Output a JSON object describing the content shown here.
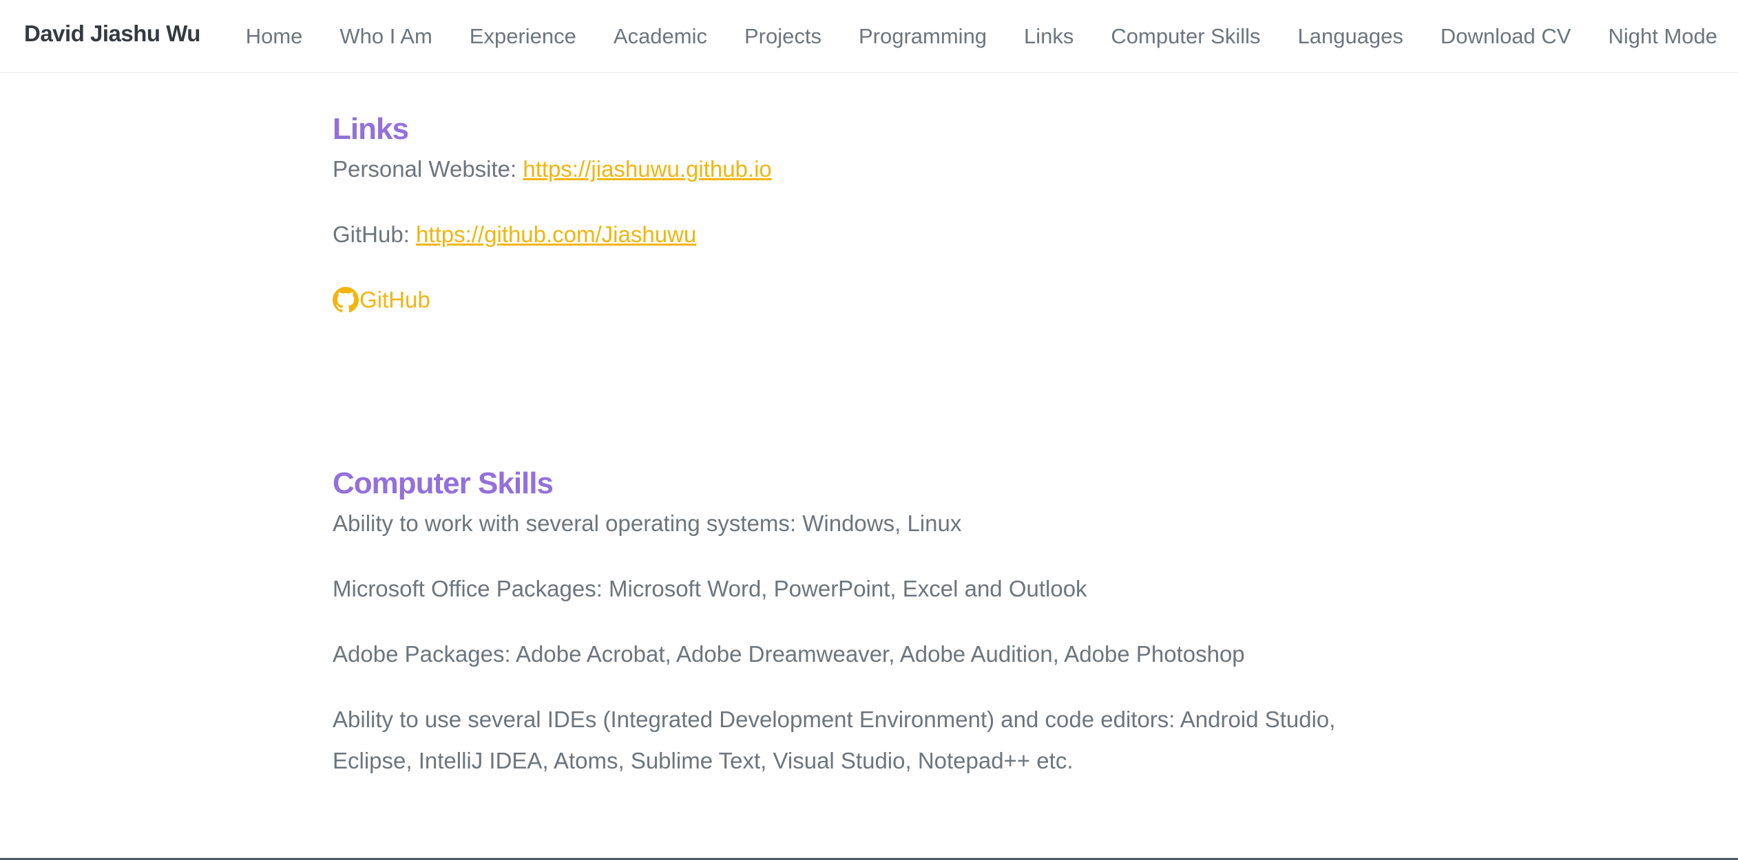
{
  "brand": "David Jiashu Wu",
  "nav": [
    {
      "label": "Home"
    },
    {
      "label": "Who I Am"
    },
    {
      "label": "Experience"
    },
    {
      "label": "Academic"
    },
    {
      "label": "Projects"
    },
    {
      "label": "Programming"
    },
    {
      "label": "Links"
    },
    {
      "label": "Computer Skills"
    },
    {
      "label": "Languages"
    },
    {
      "label": "Download CV"
    },
    {
      "label": "Night Mode"
    }
  ],
  "links_section": {
    "title": "Links",
    "website_label": "Personal Website: ",
    "website_url": "https://jiashuwu.github.io",
    "github_label": "GitHub: ",
    "github_url": "https://github.com/Jiashuwu",
    "github_button": "GitHub",
    "github_icon": "github-icon"
  },
  "skills_section": {
    "title": "Computer Skills",
    "items": [
      "Ability to work with several operating systems: Windows, Linux",
      "Microsoft Office Packages: Microsoft Word, PowerPoint, Excel and Outlook",
      "Adobe Packages: Adobe Acrobat, Adobe Dreamweaver, Adobe Audition, Adobe Photoshop",
      "Ability to use several IDEs (Integrated Development Environment) and code editors: Android Studio, Eclipse, IntelliJ IDEA, Atoms, Sublime Text, Visual Studio, Notepad++ etc."
    ]
  },
  "colors": {
    "accent_heading": "#9370db",
    "link": "#f1b50f",
    "text": "#6c757d",
    "brand": "#343a40"
  }
}
